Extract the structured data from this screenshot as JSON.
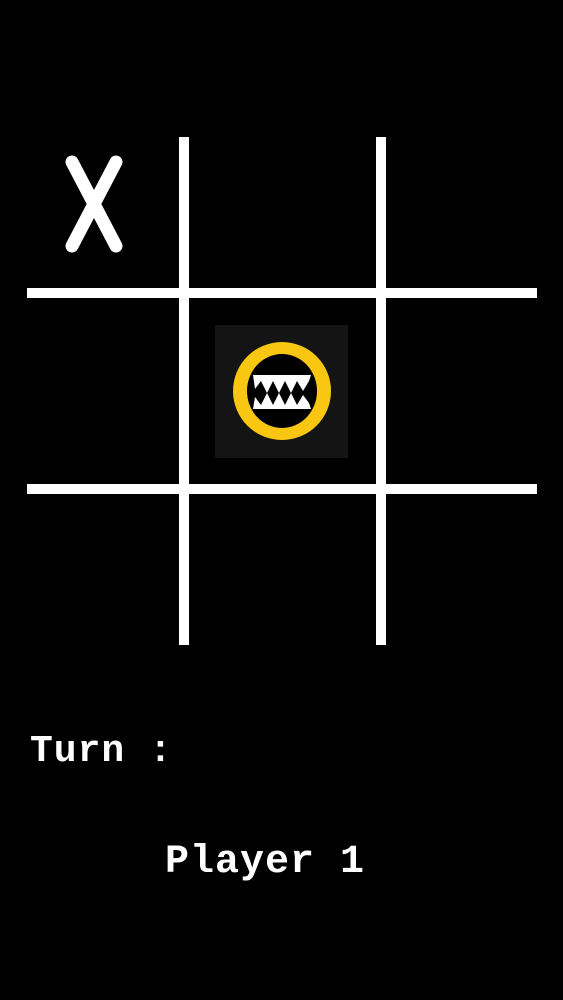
{
  "board": {
    "cells": [
      "X",
      "",
      "",
      "",
      "O",
      "",
      "",
      "",
      ""
    ],
    "colors": {
      "background": "#000000",
      "grid": "#ffffff",
      "x_mark": "#ffffff",
      "o_mark": "#f9c712",
      "o_tile": "#141414"
    },
    "o_icon": "monster-o-icon",
    "x_icon": "x-mark-icon"
  },
  "status": {
    "turn_label": "Turn :",
    "current_player": "Player 1"
  }
}
